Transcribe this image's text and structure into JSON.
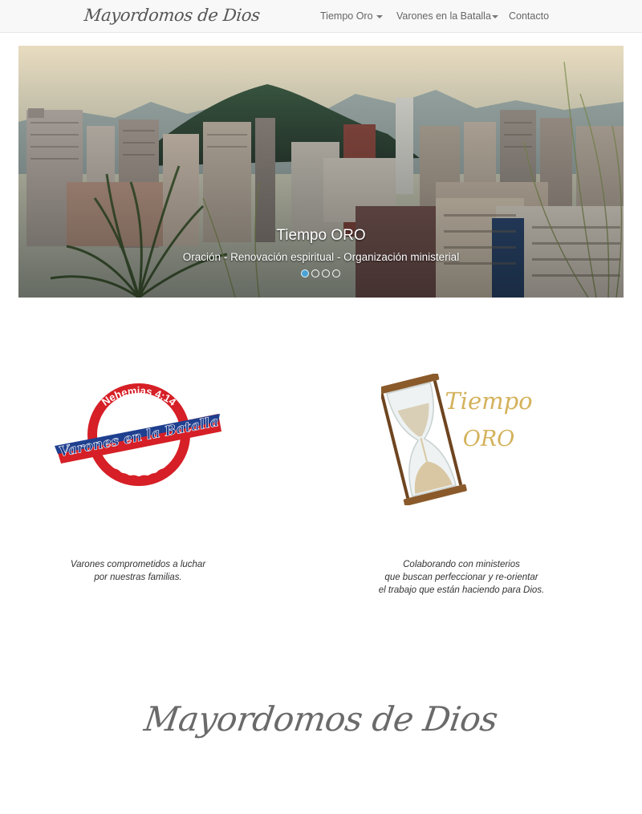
{
  "navbar": {
    "brand": "Mayordomos de Dios",
    "items": [
      {
        "label": "Tiempo Oro",
        "dropdown": true
      },
      {
        "label": "Varones en la Batalla",
        "dropdown": true
      },
      {
        "label": "Contacto",
        "dropdown": false
      }
    ]
  },
  "carousel": {
    "title": "Tiempo ORO",
    "subtitle": "Oración - Renovación espiritual - Organización ministerial",
    "slide_count": 4,
    "active_slide": 1
  },
  "features": [
    {
      "logo_top_text": "Nehemias 4:14",
      "logo_main_text": "Varones en la Batalla",
      "description_lines": [
        "Varones comprometidos a luchar",
        "por nuestras familias."
      ]
    },
    {
      "logo_line1": "Tiempo",
      "logo_line2": "ORO",
      "description_lines": [
        "Colaborando con ministerios",
        "que buscan perfeccionar y re-orientar",
        "el trabajo que están haciendo para Dios."
      ]
    }
  ],
  "footer": {
    "brand": "Mayordomos de Dios"
  },
  "colors": {
    "logo_red": "#d61f26",
    "logo_blue": "#1f3f8f",
    "oro_gold": "#d4b25c",
    "indicator_active": "#4aa3d4"
  }
}
